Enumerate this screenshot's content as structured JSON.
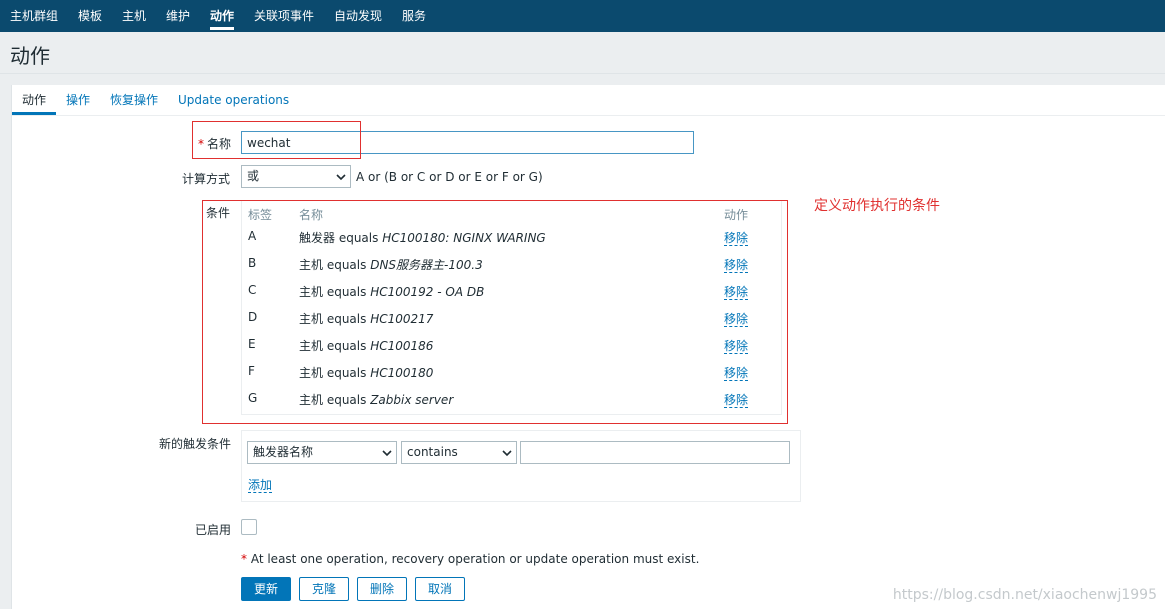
{
  "topnav": {
    "items": [
      {
        "label": "主机群组"
      },
      {
        "label": "模板"
      },
      {
        "label": "主机"
      },
      {
        "label": "维护"
      },
      {
        "label": "动作"
      },
      {
        "label": "关联项事件"
      },
      {
        "label": "自动发现"
      },
      {
        "label": "服务"
      }
    ],
    "active_index": 4
  },
  "page": {
    "title": "动作"
  },
  "tabs": [
    {
      "label": "动作"
    },
    {
      "label": "操作"
    },
    {
      "label": "恢复操作"
    },
    {
      "label": "Update operations"
    }
  ],
  "form": {
    "name": {
      "required_mark": "*",
      "label": "名称",
      "value": "wechat"
    },
    "calc": {
      "label": "计算方式",
      "selected": "或",
      "expression": "A or (B or C or D or E or F or G)"
    },
    "conditions": {
      "label": "条件",
      "headers": {
        "label": "标签",
        "name": "名称",
        "action": "动作"
      },
      "rows": [
        {
          "label": "A",
          "subject": "触发器 equals",
          "value": "HC100180: NGINX WARING",
          "action": "移除"
        },
        {
          "label": "B",
          "subject": "主机 equals",
          "value": "DNS服务器主-100.3",
          "action": "移除"
        },
        {
          "label": "C",
          "subject": "主机 equals",
          "value": "HC100192 - OA DB",
          "action": "移除"
        },
        {
          "label": "D",
          "subject": "主机 equals",
          "value": "HC100217",
          "action": "移除"
        },
        {
          "label": "E",
          "subject": "主机 equals",
          "value": "HC100186",
          "action": "移除"
        },
        {
          "label": "F",
          "subject": "主机 equals",
          "value": "HC100180",
          "action": "移除"
        },
        {
          "label": "G",
          "subject": "主机 equals",
          "value": "Zabbix server",
          "action": "移除"
        }
      ]
    },
    "new_condition": {
      "label": "新的触发条件",
      "type_selected": "触发器名称",
      "operator_selected": "contains",
      "value": "",
      "add_label": "添加"
    },
    "enabled": {
      "label": "已启用",
      "checked": false
    },
    "warning": {
      "mark": "*",
      "text": "At least one operation, recovery operation or update operation must exist."
    },
    "buttons": {
      "update": "更新",
      "clone": "克隆",
      "delete": "删除",
      "cancel": "取消"
    }
  },
  "annotation": {
    "text": "定义动作执行的条件"
  },
  "watermark": "https://blog.csdn.net/xiaochenwj1995",
  "colors": {
    "nav": "#0b4a6e",
    "link": "#0275b8",
    "annotation": "#e0302f",
    "page_bg": "#ebeef0"
  },
  "icons": [
    "chevron-down-icon"
  ]
}
